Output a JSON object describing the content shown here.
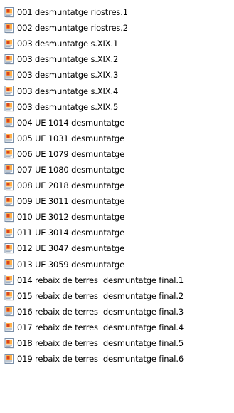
{
  "files": [
    {
      "name": "001 desmuntatge riostres.1",
      "icon": "presentation-file-icon"
    },
    {
      "name": "002 desmuntatge riostres.2",
      "icon": "presentation-file-icon"
    },
    {
      "name": "003 desmuntatge s.XIX.1",
      "icon": "presentation-file-icon"
    },
    {
      "name": "003 desmuntatge s.XIX.2",
      "icon": "presentation-file-icon"
    },
    {
      "name": "003 desmuntatge s.XIX.3",
      "icon": "presentation-file-icon"
    },
    {
      "name": "003 desmuntatge s.XIX.4",
      "icon": "presentation-file-icon"
    },
    {
      "name": "003 desmuntatge s.XIX.5",
      "icon": "presentation-file-icon"
    },
    {
      "name": "004 UE 1014 desmuntatge",
      "icon": "presentation-file-icon"
    },
    {
      "name": "005 UE 1031 desmuntatge",
      "icon": "presentation-file-icon"
    },
    {
      "name": "006 UE 1079 desmuntatge",
      "icon": "presentation-file-icon"
    },
    {
      "name": "007 UE 1080 desmuntatge",
      "icon": "presentation-file-icon"
    },
    {
      "name": "008 UE 2018 desmuntatge",
      "icon": "presentation-file-icon"
    },
    {
      "name": "009 UE 3011 desmuntatge",
      "icon": "presentation-file-icon"
    },
    {
      "name": "010 UE 3012 desmuntatge",
      "icon": "presentation-file-icon"
    },
    {
      "name": "011 UE 3014 desmuntatge",
      "icon": "presentation-file-icon"
    },
    {
      "name": "012 UE 3047 desmuntatge",
      "icon": "presentation-file-icon"
    },
    {
      "name": "013 UE 3059 desmuntatge",
      "icon": "presentation-file-icon"
    },
    {
      "name": "014 rebaix de terres  desmuntatge final.1",
      "icon": "presentation-file-icon"
    },
    {
      "name": "015 rebaix de terres  desmuntatge final.2",
      "icon": "presentation-file-icon"
    },
    {
      "name": "016 rebaix de terres  desmuntatge final.3",
      "icon": "presentation-file-icon"
    },
    {
      "name": "017 rebaix de terres  desmuntatge final.4",
      "icon": "presentation-file-icon"
    },
    {
      "name": "018 rebaix de terres  desmuntatge final.5",
      "icon": "presentation-file-icon"
    },
    {
      "name": "019 rebaix de terres  desmuntatge final.6",
      "icon": "presentation-file-icon"
    }
  ],
  "colors": {
    "icon_frame": "#7a8fa8",
    "icon_page": "#fdfdfd",
    "icon_slide": "#ffb14a",
    "icon_accent": "#d8441e",
    "icon_shadow": "#d9d9d9"
  }
}
